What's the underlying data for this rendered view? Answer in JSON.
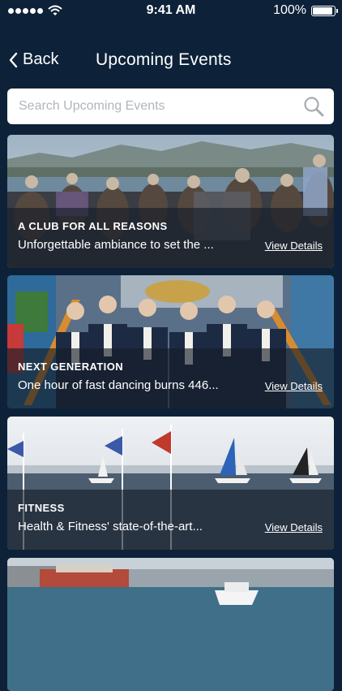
{
  "status_bar": {
    "time": "9:41 AM",
    "battery_percent": "100%"
  },
  "nav": {
    "back_label": "Back",
    "title": "Upcoming Events"
  },
  "search": {
    "placeholder": "Search Upcoming Events"
  },
  "events": [
    {
      "category": "A CLUB FOR ALL REASONS",
      "description": "Unforgettable ambiance to set the ...",
      "link": "View Details"
    },
    {
      "category": "NEXT GENERATION",
      "description": "One hour of fast dancing burns 446...",
      "link": "View Details"
    },
    {
      "category": "FITNESS",
      "description": "Health & Fitness' state-of-the-art...",
      "link": "View Details"
    }
  ],
  "icons": {
    "back": "chevron-left-icon",
    "search": "magnifier-icon",
    "wifi": "wifi-icon",
    "battery": "battery-icon"
  },
  "colors": {
    "background": "#0d2238",
    "overlay": "#141c26",
    "white": "#ffffff"
  }
}
